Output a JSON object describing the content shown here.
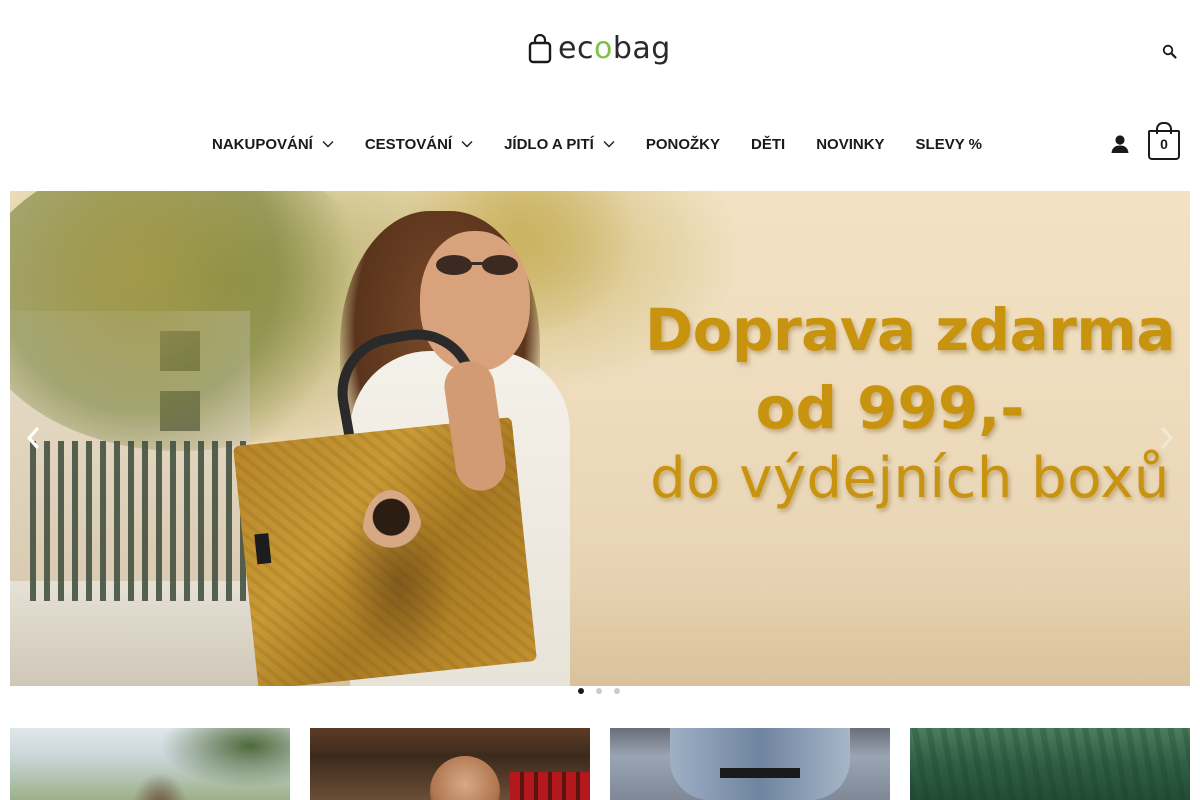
{
  "brand": {
    "logo_text_1": "ec",
    "logo_text_o": "o",
    "logo_text_2": "bag",
    "accent_color": "#7cc243"
  },
  "header": {
    "search_icon": "search-icon",
    "nav": [
      {
        "label": "NAKUPOVÁNÍ",
        "has_dropdown": true
      },
      {
        "label": "CESTOVÁNÍ",
        "has_dropdown": true
      },
      {
        "label": "JÍDLO A PITÍ",
        "has_dropdown": true
      },
      {
        "label": "PONOŽKY",
        "has_dropdown": false
      },
      {
        "label": "DĚTI",
        "has_dropdown": false
      },
      {
        "label": "NOVINKY",
        "has_dropdown": false
      },
      {
        "label": "SLEVY %",
        "has_dropdown": false
      }
    ],
    "account_icon": "user-icon",
    "cart": {
      "icon": "shopping-bag-icon",
      "count": "0"
    }
  },
  "hero": {
    "headline_1": "Doprava zdarma",
    "headline_2": "od 999,-",
    "headline_3": "do výdejních boxů",
    "headline_color": "#c8940f",
    "slide_count": 3,
    "active_slide": 1,
    "prev_icon": "chevron-left-icon",
    "next_icon": "chevron-right-icon"
  },
  "categories": {
    "count": 4
  }
}
